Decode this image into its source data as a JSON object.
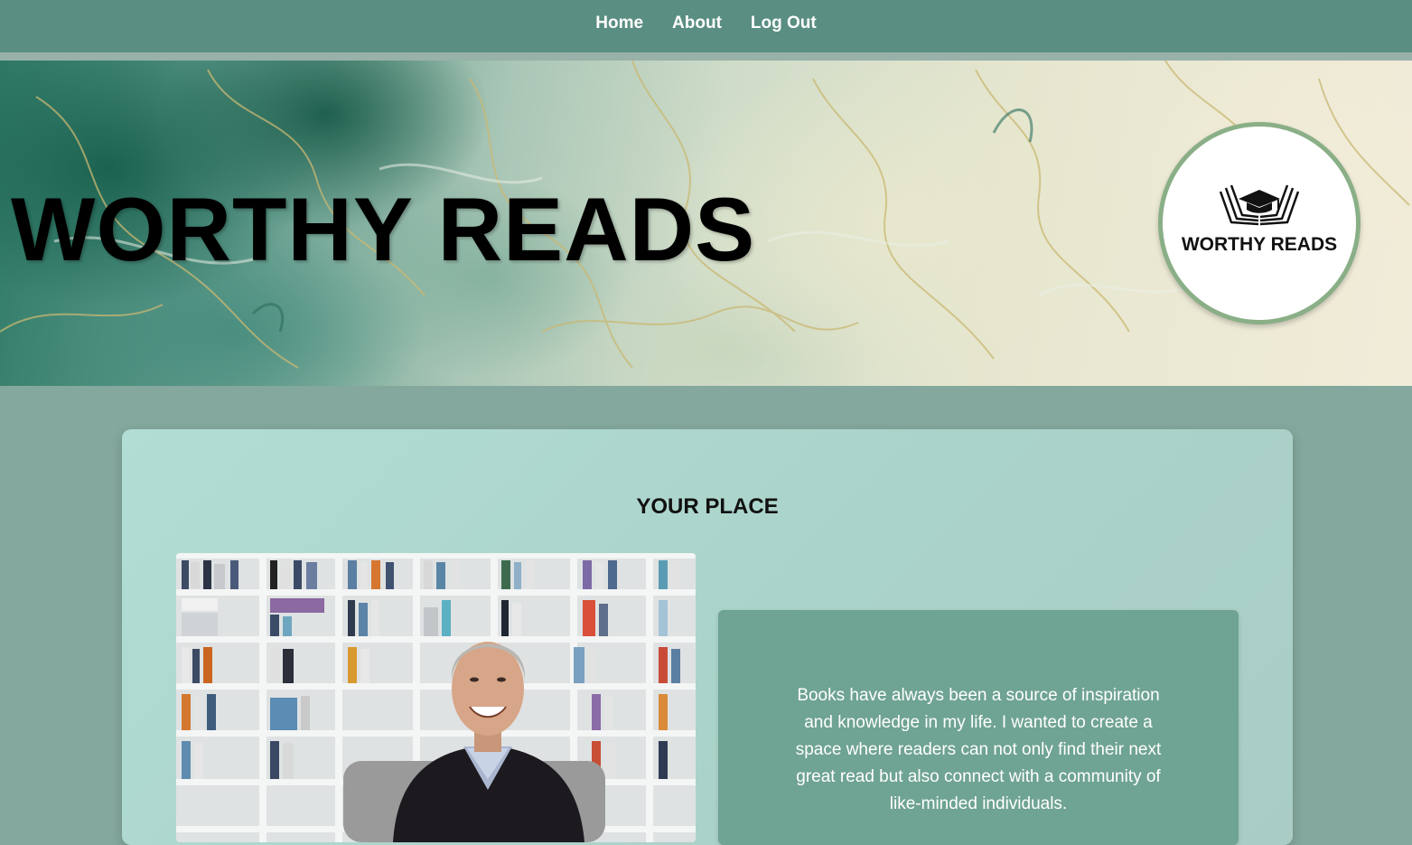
{
  "nav": {
    "items": [
      {
        "label": "Home"
      },
      {
        "label": "About"
      },
      {
        "label": "Log Out"
      }
    ]
  },
  "hero": {
    "title": "WORTHY READS",
    "logo_text": "WORTHY READS"
  },
  "main": {
    "section_title": "YOUR PLACE",
    "about_text": "Books have always been a source of inspiration and knowledge in my life. I wanted to create a space where readers can not only find their next great read but also connect with a community of like-minded individuals."
  },
  "colors": {
    "nav_bg": "#5a8e82",
    "page_bg": "#84a89d",
    "card_bg": "#aed8cf",
    "textbox_bg": "#6fa393",
    "logo_border": "#8aaf87"
  },
  "icons": [
    "book-graduation-cap-logo-icon"
  ]
}
